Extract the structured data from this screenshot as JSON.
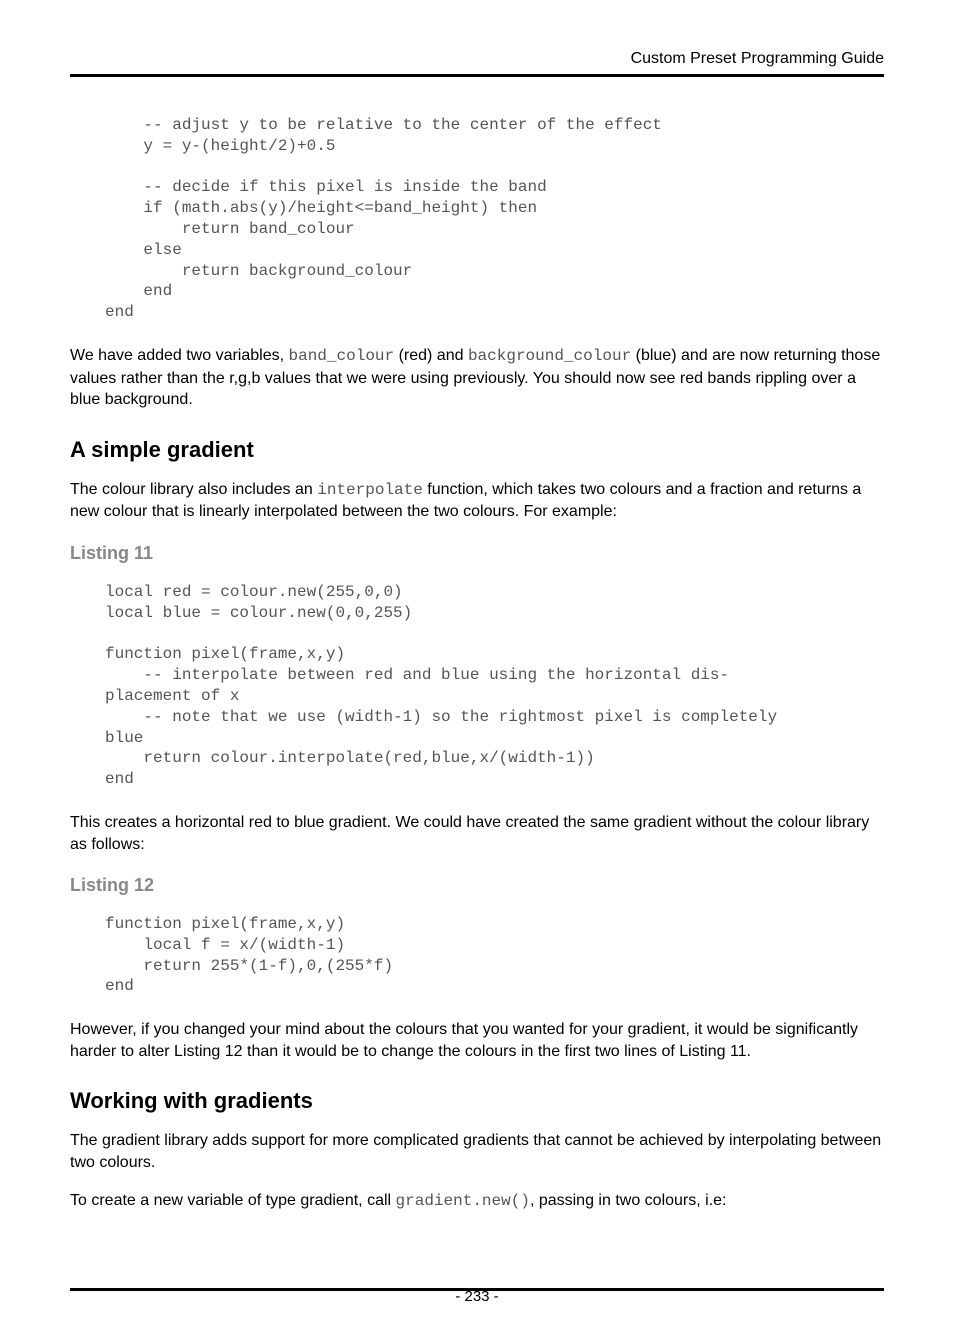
{
  "header": {
    "title": "Custom Preset Programming Guide"
  },
  "codeBlock1": "    -- adjust y to be relative to the center of the effect\n    y = y-(height/2)+0.5\n\n    -- decide if this pixel is inside the band\n    if (math.abs(y)/height<=band_height) then\n        return band_colour\n    else\n        return background_colour\n    end\nend",
  "paragraph1": {
    "a": "We have added two variables, ",
    "code1": "band_colour",
    "b": " (red) and ",
    "code2": "background_colour",
    "c": " (blue) and are now returning those values rather than the r,g,b values that we were using previously. You should now see red bands rippling over a blue background."
  },
  "heading1": "A simple gradient",
  "paragraph2": {
    "a": "The colour library also includes an ",
    "code1": "interpolate",
    "b": " function, which takes two colours and a fraction and returns a new colour that is linearly interpolated between the two colours. For example:"
  },
  "listing11Label": "Listing 11",
  "codeBlock2": "local red = colour.new(255,0,0)\nlocal blue = colour.new(0,0,255)\n\nfunction pixel(frame,x,y)\n    -- interpolate between red and blue using the horizontal dis-\nplacement of x\n    -- note that we use (width-1) so the rightmost pixel is completely\nblue\n    return colour.interpolate(red,blue,x/(width-1))\nend",
  "paragraph3": "This creates a horizontal red to blue gradient. We could have created the same gradient without the colour library as follows:",
  "listing12Label": "Listing 12",
  "codeBlock3": "function pixel(frame,x,y)\n    local f = x/(width-1)\n    return 255*(1-f),0,(255*f)\nend",
  "paragraph4": "However, if you changed your mind about the colours that you wanted for your gradient, it would be significantly harder to alter Listing 12 than it would be to change the colours in the first two lines of Listing 11.",
  "heading2": "Working with gradients",
  "paragraph5": "The gradient library adds support for more complicated gradients that cannot be achieved by interpolating between two colours.",
  "paragraph6": {
    "a": "To create a new variable of type gradient, call ",
    "code1": "gradient.new()",
    "b": ", passing in two colours, i.e:"
  },
  "pageNumber": "- 233 -"
}
